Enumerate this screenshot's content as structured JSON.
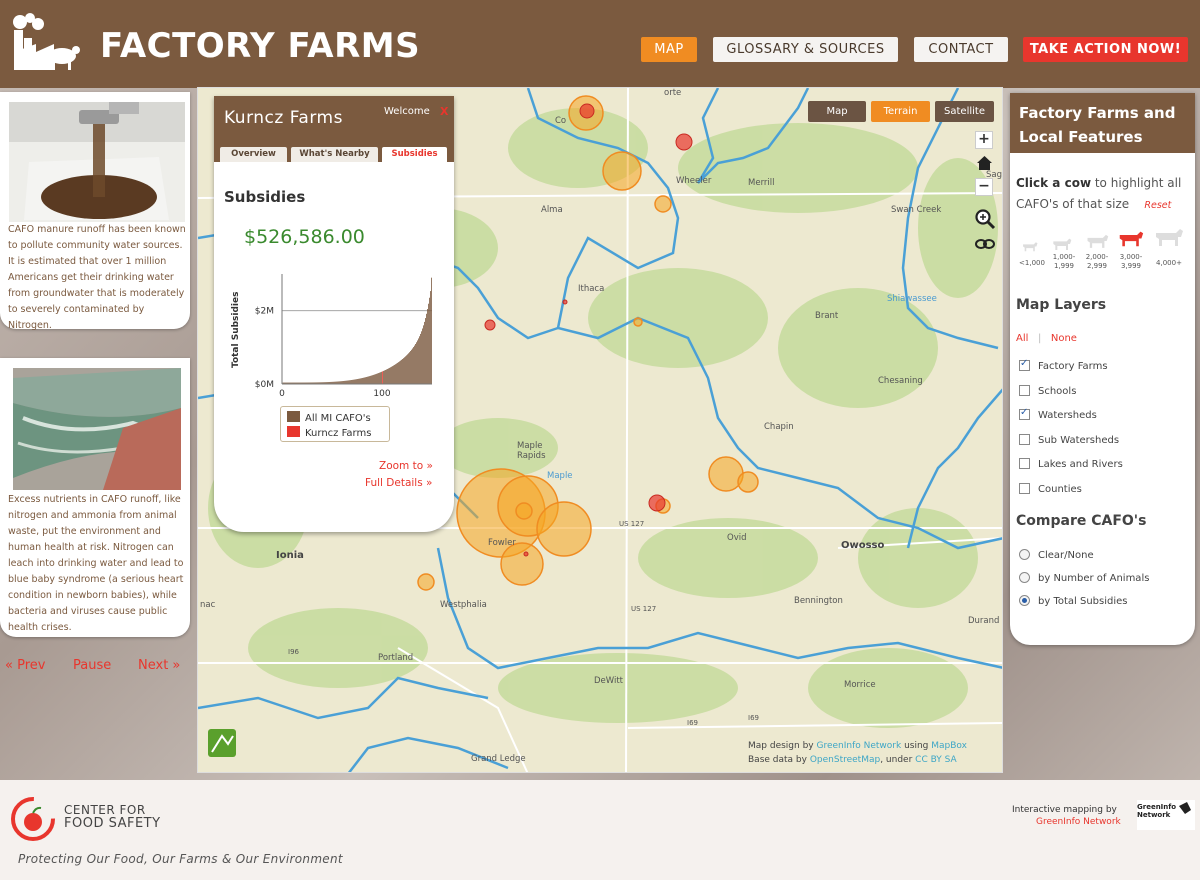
{
  "header": {
    "title": "FACTORY FARMS",
    "nav": {
      "map": "MAP",
      "glossary": "GLOSSARY & SOURCES",
      "contact": "CONTACT",
      "action": "TAKE ACTION NOW!"
    }
  },
  "slides": {
    "slide1_text": "CAFO manure runoff has been known to pollute community water sources. It is estimated that over 1 million Americans get their drinking water from groundwater that is moderately to severely contaminated by Nitrogen.",
    "slide2_text": "Excess nutrients in CAFO runoff, like nitrogen and ammonia from animal waste, put the environment and human health at risk. Nitrogen can leach into drinking water and lead to blue baby syndrome (a serious heart condition in newborn babies), while bacteria and viruses cause public health crises.",
    "prev": "« Prev",
    "pause": "Pause",
    "next": "Next »"
  },
  "map": {
    "type_buttons": {
      "map": "Map",
      "terrain": "Terrain",
      "satellite": "Satellite"
    },
    "zoom": {
      "in": "+",
      "out": "−"
    },
    "labels": {
      "coleman": "Co",
      "wheeler": "Wheeler",
      "merrill": "Merrill",
      "alma": "Alma",
      "sag": "Sag",
      "swan_creek": "Swan Creek",
      "ithaca": "Ithaca",
      "shiawassee": "Shiawassee",
      "brant": "Brant",
      "chesaning": "Chesaning",
      "chapin": "Chapin",
      "maple_rapids": "Maple\nRapids",
      "maple": "Maple",
      "us127a": "US 127",
      "ovid": "Ovid",
      "owosso": "Owosso",
      "ionia": "Ionia",
      "fowler": "Fowler",
      "westphalia": "Westphalia",
      "us127b": "US 127",
      "bennington": "Bennington",
      "durand": "Durand",
      "nac": "nac",
      "i96": "I96",
      "portland": "Portland",
      "dewitt": "DeWitt",
      "morrice": "Morrice",
      "i69a": "I69",
      "i69b": "I69",
      "grand_ledge": "Grand Ledge",
      "porte": "orte",
      "coh": "Coh"
    },
    "credits": {
      "line1_a": "Map design by ",
      "line1_link1": "GreenInfo Network",
      "line1_b": " using ",
      "line1_link2": "MapBox",
      "line2_a": "Base data by ",
      "line2_link1": "OpenStreetMap",
      "line2_b": ", under ",
      "line2_link2": "CC BY SA"
    },
    "colors": {
      "water": "#4aa0d6",
      "cafo_orange": "#f5a623",
      "cafo_red": "#e8362d",
      "green": "#c8dca0"
    }
  },
  "info": {
    "farm_name": "Kurncz Farms",
    "welcome": "Welcome",
    "close": "X",
    "tabs": {
      "overview": "Overview",
      "nearby": "What's Nearby",
      "subsidies": "Subsidies"
    },
    "title": "Subsidies",
    "amount": "$526,586.00",
    "legend": {
      "all": "All MI CAFO's",
      "farm": "Kurncz Farms"
    },
    "zoom_to": "Zoom to »",
    "full_details": "Full Details »"
  },
  "chart_data": {
    "type": "bar",
    "ylabel": "Total Subsidies",
    "ytick_labels": [
      "$0M",
      "$2M"
    ],
    "xtick_labels": [
      "0",
      "100"
    ],
    "x_range": [
      0,
      150
    ],
    "y_range": [
      0,
      3000000
    ],
    "highlight_index": 100,
    "series": [
      {
        "name": "All MI CAFO's",
        "color": "#7b5a3f"
      },
      {
        "name": "Kurncz Farms",
        "color": "#e8362d"
      }
    ]
  },
  "right_panel": {
    "title": "Factory Farms and Local Features",
    "click_bold": "Click a cow",
    "click_rest": " to highlight all CAFO's of that size",
    "reset": "Reset",
    "cows": [
      "<1,000",
      "1,000-\n1,999",
      "2,000-\n2,999",
      "3,000-\n3,999",
      "4,000+"
    ],
    "layers_title": "Map Layers",
    "all": "All",
    "none": "None",
    "layers": [
      {
        "label": "Factory Farms",
        "checked": true
      },
      {
        "label": "Schools",
        "checked": false
      },
      {
        "label": "Watersheds",
        "checked": true
      },
      {
        "label": "Sub Watersheds",
        "checked": false
      },
      {
        "label": "Lakes and Rivers",
        "checked": false
      },
      {
        "label": "Counties",
        "checked": false
      }
    ],
    "compare_title": "Compare CAFO's",
    "compare": [
      {
        "label": "Clear/None",
        "selected": false
      },
      {
        "label": "by Number of Animals",
        "selected": false
      },
      {
        "label": "by Total Subsidies",
        "selected": true
      }
    ]
  },
  "footer": {
    "org_line1": "CENTER FOR",
    "org_line2": "FOOD SAFETY",
    "tagline": "Protecting Our Food, Our Farms & Our Environment",
    "interactive": "Interactive mapping by",
    "gin_link": "GreenInfo Network",
    "gin_logo_text": "GreenInfo\nNetwork"
  }
}
